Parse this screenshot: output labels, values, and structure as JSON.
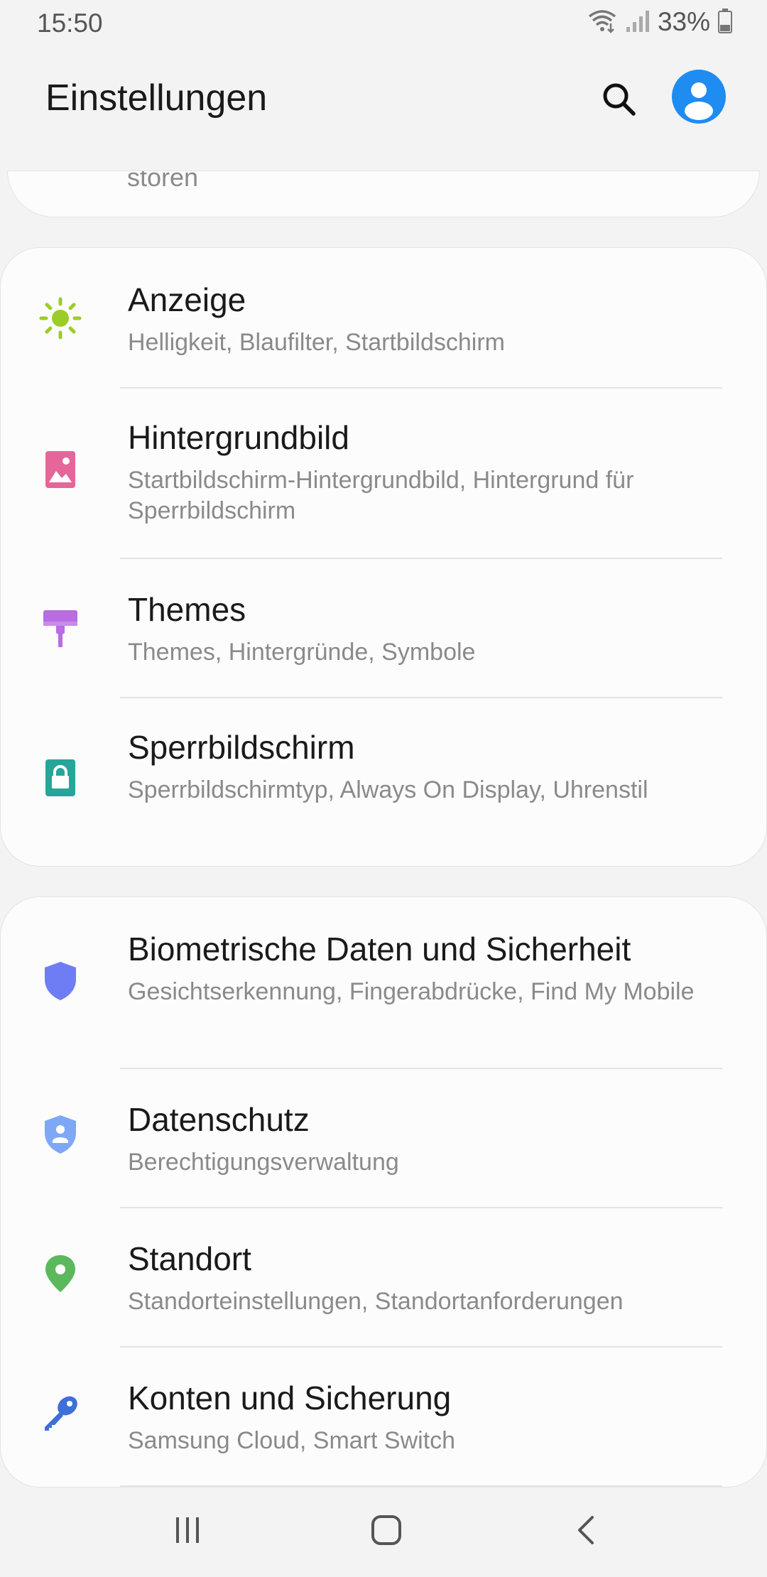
{
  "status_bar": {
    "time": "15:50",
    "battery": "33%"
  },
  "app_bar": {
    "title": "Einstellungen"
  },
  "top_partial": {
    "subtitle": "stören"
  },
  "group1": [
    {
      "title": "Anzeige",
      "subtitle": "Helligkeit, Blaufilter, Startbildschirm",
      "icon": "sun-icon",
      "color": "#9ccc2a"
    },
    {
      "title": "Hintergrundbild",
      "subtitle": "Startbildschirm-Hintergrundbild, Hintergrund für Sperrbildschirm",
      "icon": "image-icon",
      "color": "#e5669a"
    },
    {
      "title": "Themes",
      "subtitle": "Themes, Hintergründe, Symbole",
      "icon": "paintbrush-icon",
      "color": "#b86de0"
    },
    {
      "title": "Sperrbildschirm",
      "subtitle": "Sperrbildschirmtyp, Always On Display, Uhrenstil",
      "icon": "lock-icon",
      "color": "#26a69a"
    }
  ],
  "group2": [
    {
      "title": "Biometrische Daten und Sicherheit",
      "subtitle": "Gesichtserkennung, Fingerabdrücke, Find My Mobile",
      "icon": "shield-icon",
      "color": "#6f7df5"
    },
    {
      "title": "Datenschutz",
      "subtitle": "Berechtigungsverwaltung",
      "icon": "privacy-shield-icon",
      "color": "#7ea8f5"
    },
    {
      "title": "Standort",
      "subtitle": "Standorteinstellungen, Standortanforderungen",
      "icon": "location-pin-icon",
      "color": "#5cb85c"
    },
    {
      "title": "Konten und Sicherung",
      "subtitle": "Samsung Cloud, Smart Switch",
      "icon": "key-icon",
      "color": "#3f6fd8"
    }
  ]
}
